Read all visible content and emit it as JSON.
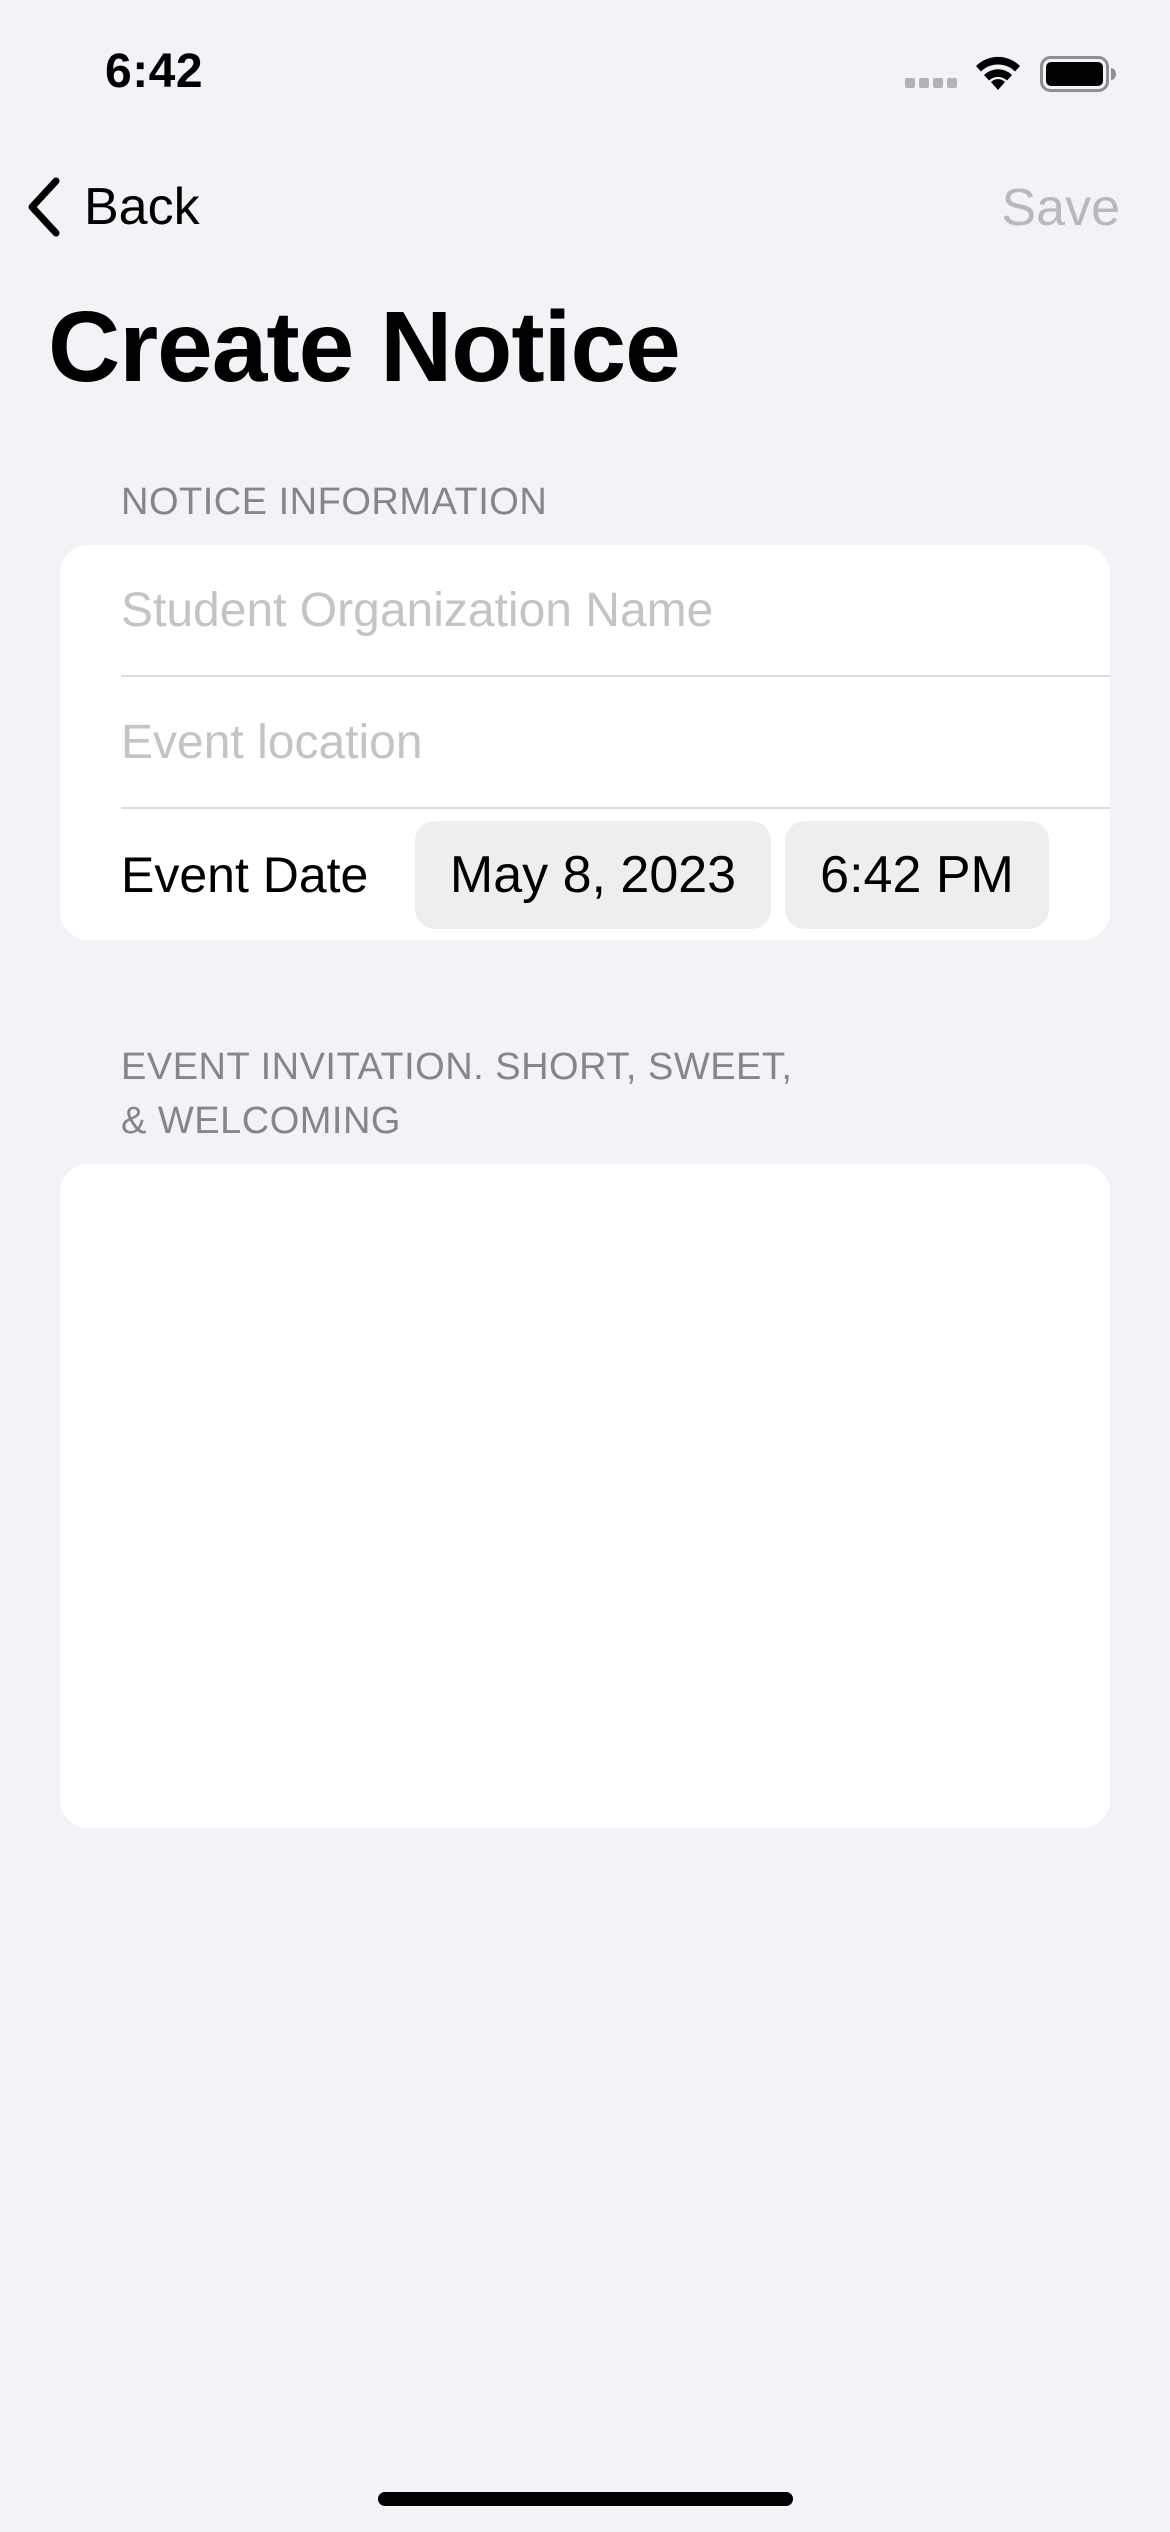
{
  "status_bar": {
    "time": "6:42",
    "icons": [
      "cellular-signal-icon",
      "wifi-icon",
      "battery-icon"
    ]
  },
  "nav": {
    "back_icon": "chevron-left-icon",
    "back_label": "Back",
    "save_label": "Save",
    "save_enabled": false
  },
  "page": {
    "title": "Create Notice"
  },
  "notice_section": {
    "header": "NOTICE INFORMATION",
    "org_name": {
      "value": "",
      "placeholder": "Student Organization Name"
    },
    "location": {
      "value": "",
      "placeholder": "Event location"
    },
    "event_date": {
      "label": "Event Date",
      "date": "May 8, 2023",
      "time": "6:42 PM"
    }
  },
  "invitation_section": {
    "header_line1": "EVENT INVITATION. SHORT, SWEET,",
    "header_line2": "& WELCOMING",
    "text": ""
  },
  "colors": {
    "background": "#f2f2f7",
    "card": "#ffffff",
    "section_header": "#85858b",
    "placeholder": "#c4c4c7",
    "disabled_button": "#b9b9bd",
    "pill": "#eeeeef"
  }
}
